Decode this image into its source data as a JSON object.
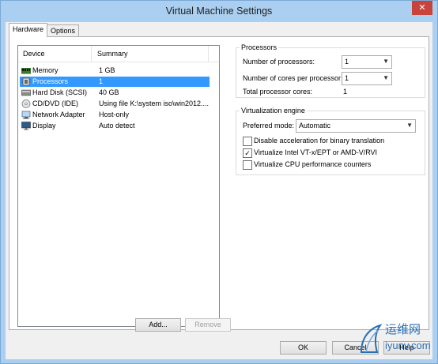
{
  "window": {
    "title": "Virtual Machine Settings",
    "close_glyph": "✕"
  },
  "tabs": [
    {
      "label": "Hardware"
    },
    {
      "label": "Options"
    }
  ],
  "device_list": {
    "headers": {
      "device": "Device",
      "summary": "Summary"
    },
    "rows": [
      {
        "device": "Memory",
        "summary": "1 GB",
        "icon": "memory-icon"
      },
      {
        "device": "Processors",
        "summary": "1",
        "icon": "processor-icon"
      },
      {
        "device": "Hard Disk (SCSI)",
        "summary": "40 GB",
        "icon": "hard-disk-icon"
      },
      {
        "device": "CD/DVD (IDE)",
        "summary": "Using file K:\\system iso\\win2012....",
        "icon": "cd-dvd-icon"
      },
      {
        "device": "Network Adapter",
        "summary": "Host-only",
        "icon": "network-adapter-icon"
      },
      {
        "device": "Display",
        "summary": "Auto detect",
        "icon": "display-icon"
      }
    ],
    "selected_index": 1
  },
  "list_buttons": {
    "add": "Add...",
    "remove": "Remove"
  },
  "processors": {
    "group_title": "Processors",
    "num_processors_label": "Number of processors:",
    "num_processors_value": "1",
    "cores_label": "Number of cores per processor:",
    "cores_value": "1",
    "total_label": "Total processor cores:",
    "total_value": "1"
  },
  "virtualization": {
    "group_title": "Virtualization engine",
    "mode_label": "Preferred mode:",
    "mode_value": "Automatic",
    "options": [
      {
        "label": "Disable acceleration for binary translation",
        "checked": false
      },
      {
        "label": "Virtualize Intel VT-x/EPT or AMD-V/RVI",
        "checked": true
      },
      {
        "label": "Virtualize CPU performance counters",
        "checked": false
      }
    ]
  },
  "dialog_buttons": {
    "ok": "OK",
    "cancel": "Cancel",
    "help": "Help"
  },
  "watermark": {
    "chinese": "运维网",
    "url": "iyunv.com"
  },
  "colors": {
    "selection": "#3399ff",
    "titlebar": "#abcff0",
    "close": "#c7433b",
    "watermark": "#2b6fb3"
  }
}
